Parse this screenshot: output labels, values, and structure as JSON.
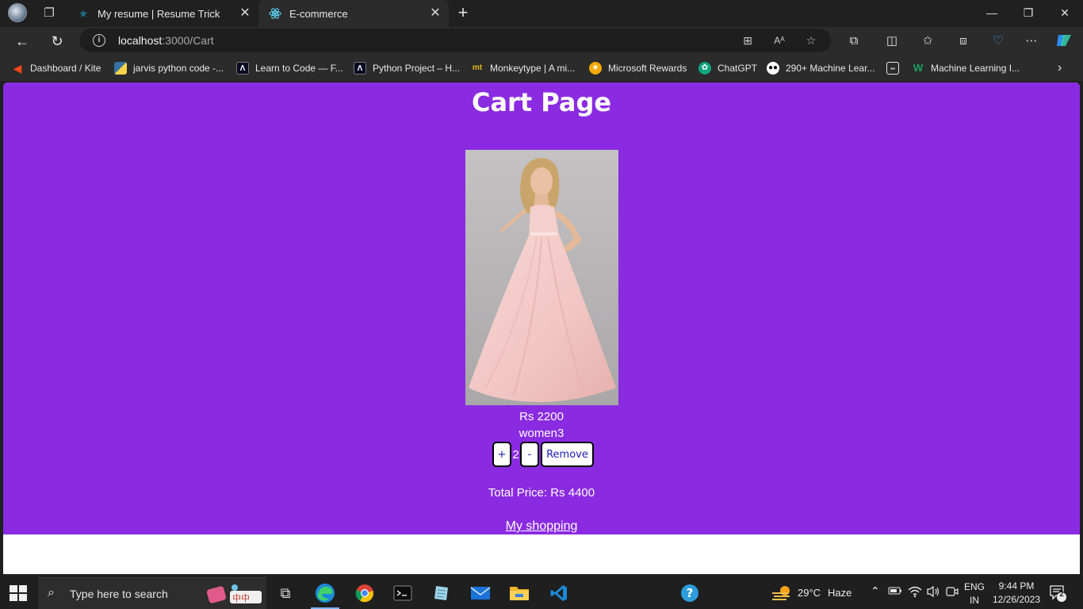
{
  "browser": {
    "tabs": [
      {
        "label": "My resume | Resume Trick",
        "icon": "star-favicon-icon",
        "active": false
      },
      {
        "label": "E-commerce",
        "icon": "react-favicon-icon",
        "active": true
      }
    ],
    "address": {
      "host": "localhost",
      "path": ":3000/Cart"
    },
    "bookmarks": [
      {
        "label": "Dashboard / Kite",
        "icon": "kite-icon",
        "color": "#f6461a"
      },
      {
        "label": "jarvis python code -...",
        "icon": "python-icon",
        "color": "#3670a0"
      },
      {
        "label": "Learn to Code — F...",
        "icon": "freecodecamp-icon",
        "color": "#0a0a23"
      },
      {
        "label": "Python Project – H...",
        "icon": "freecodecamp-icon",
        "color": "#0a0a23"
      },
      {
        "label": "Monkeytype | A mi...",
        "icon": "monkeytype-icon",
        "color": "#e2b714"
      },
      {
        "label": "Microsoft Rewards",
        "icon": "rewards-medal-icon",
        "color": "#f2a900"
      },
      {
        "label": "ChatGPT",
        "icon": "chatgpt-icon",
        "color": "#10a37f"
      },
      {
        "label": "290+ Machine Lear...",
        "icon": "medium-icon",
        "color": "#000000"
      },
      {
        "label": "",
        "icon": "calendar-icon",
        "color": "#e8e8e8"
      },
      {
        "label": "Machine Learning I...",
        "icon": "w-logo-icon",
        "color": "#1aa260"
      }
    ]
  },
  "page": {
    "title": "Cart Page",
    "background": "#8a2be2",
    "product": {
      "price": "Rs 2200",
      "name": "women3",
      "image": "pink-gown-model-photo",
      "quantity": "2",
      "plus_label": "+",
      "minus_label": "-",
      "remove_label": "Remove"
    },
    "total": "Total Price: Rs 4400",
    "link": "My shopping"
  },
  "taskbar": {
    "search_placeholder": "Type here to search",
    "apps": [
      "task-view-icon",
      "edge-icon",
      "chrome-icon",
      "terminal-icon",
      "notes-app-icon",
      "mail-icon",
      "file-explorer-icon",
      "vscode-icon"
    ],
    "help_icon": "help-icon",
    "weather_temp": "29°C",
    "weather_text": "Haze",
    "lang": "ENG",
    "region": "IN",
    "time": "9:44 PM",
    "date": "12/26/2023",
    "notifications": "2"
  }
}
